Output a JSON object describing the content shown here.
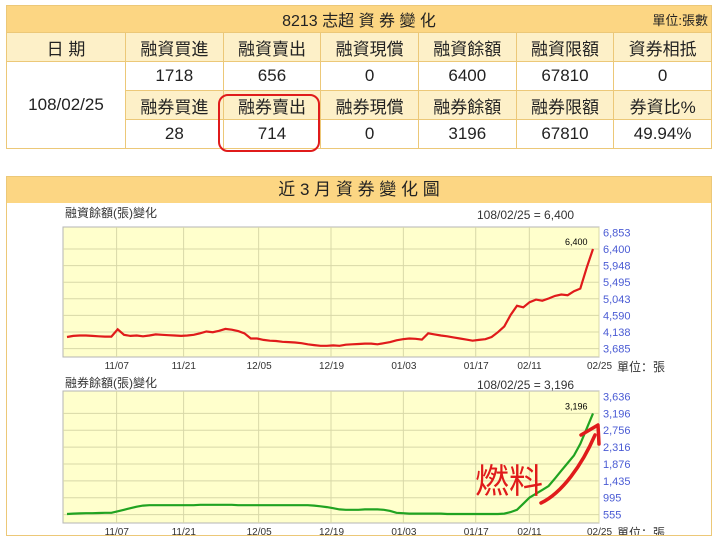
{
  "table": {
    "title": "8213 志超 資 券 變 化",
    "unit": "單位:張數",
    "date_header": "日 期",
    "date": "108/02/25",
    "row1_headers": [
      "融資買進",
      "融資賣出",
      "融資現償",
      "融資餘額",
      "融資限額",
      "資券相抵"
    ],
    "row1_values": [
      "1718",
      "656",
      "0",
      "6400",
      "67810",
      "0"
    ],
    "row2_headers": [
      "融券買進",
      "融券賣出",
      "融券現償",
      "融券餘額",
      "融券限額",
      "券資比%"
    ],
    "row2_values": [
      "28",
      "714",
      "0",
      "3196",
      "67810",
      "49.94%"
    ]
  },
  "panel": {
    "title": "近 3 月 資 券 變 化 圖"
  },
  "annotation": {
    "text": "燃料",
    "color": "#e01b1b"
  },
  "chart_data": [
    {
      "type": "line",
      "title": "融資餘額(張)變化",
      "readout": "108/02/25 = 6,400",
      "last_label": "6,400",
      "unit": "單位：張",
      "x_ticks": [
        "11/07",
        "11/21",
        "12/05",
        "12/19",
        "01/03",
        "01/17",
        "02/11",
        "02/25"
      ],
      "y_ticks": [
        "6,853",
        "6,400",
        "5,948",
        "5,495",
        "5,043",
        "4,590",
        "4,138",
        "3,685"
      ],
      "ylim": [
        3455,
        7000
      ],
      "color": "#e01b1b",
      "grid": true,
      "series": [
        {
          "values": [
            4000,
            4030,
            4040,
            4040,
            4030,
            4020,
            4010,
            4010,
            4210,
            4060,
            4030,
            4040,
            4020,
            4040,
            4070,
            4060,
            4050,
            4040,
            4030,
            4040,
            4060,
            4100,
            4150,
            4130,
            4170,
            4220,
            4200,
            4160,
            4100,
            3960,
            3960,
            3920,
            3900,
            3890,
            3870,
            3860,
            3850,
            3830,
            3800,
            3780,
            3760,
            3760,
            3770,
            3760,
            3790,
            3800,
            3810,
            3820,
            3820,
            3800,
            3830,
            3860,
            3910,
            3940,
            3960,
            3950,
            3930,
            4100,
            4070,
            4040,
            4020,
            3990,
            3960,
            3930,
            3900,
            3920,
            3940,
            4000,
            4130,
            4290,
            4600,
            4850,
            4810,
            4950,
            5020,
            4990,
            5050,
            5120,
            5160,
            5140,
            5250,
            5320,
            5890,
            6400
          ]
        }
      ]
    },
    {
      "type": "line",
      "title": "融券餘額(張)變化",
      "readout": "108/02/25 = 3,196",
      "last_label": "3,196",
      "unit": "單位：張",
      "x_ticks": [
        "11/07",
        "11/21",
        "12/05",
        "12/19",
        "01/03",
        "01/17",
        "02/11",
        "02/25"
      ],
      "y_ticks": [
        "3,636",
        "3,196",
        "2,756",
        "2,316",
        "1,876",
        "1,435",
        "995",
        "555"
      ],
      "ylim": [
        335,
        3780
      ],
      "color": "#21a321",
      "grid": true,
      "series": [
        {
          "values": [
            570,
            580,
            585,
            590,
            590,
            595,
            600,
            600,
            640,
            680,
            720,
            760,
            790,
            800,
            800,
            800,
            800,
            800,
            800,
            800,
            800,
            810,
            810,
            810,
            810,
            810,
            810,
            800,
            800,
            800,
            800,
            800,
            800,
            800,
            800,
            800,
            800,
            800,
            800,
            790,
            770,
            750,
            720,
            690,
            680,
            680,
            680,
            690,
            690,
            690,
            680,
            650,
            600,
            590,
            580,
            580,
            580,
            580,
            580,
            580,
            570,
            570,
            570,
            570,
            570,
            570,
            570,
            570,
            570,
            580,
            620,
            680,
            840,
            1000,
            1100,
            1200,
            1300,
            1500,
            1700,
            1900,
            2100,
            2400,
            2800,
            3196
          ]
        }
      ]
    }
  ]
}
